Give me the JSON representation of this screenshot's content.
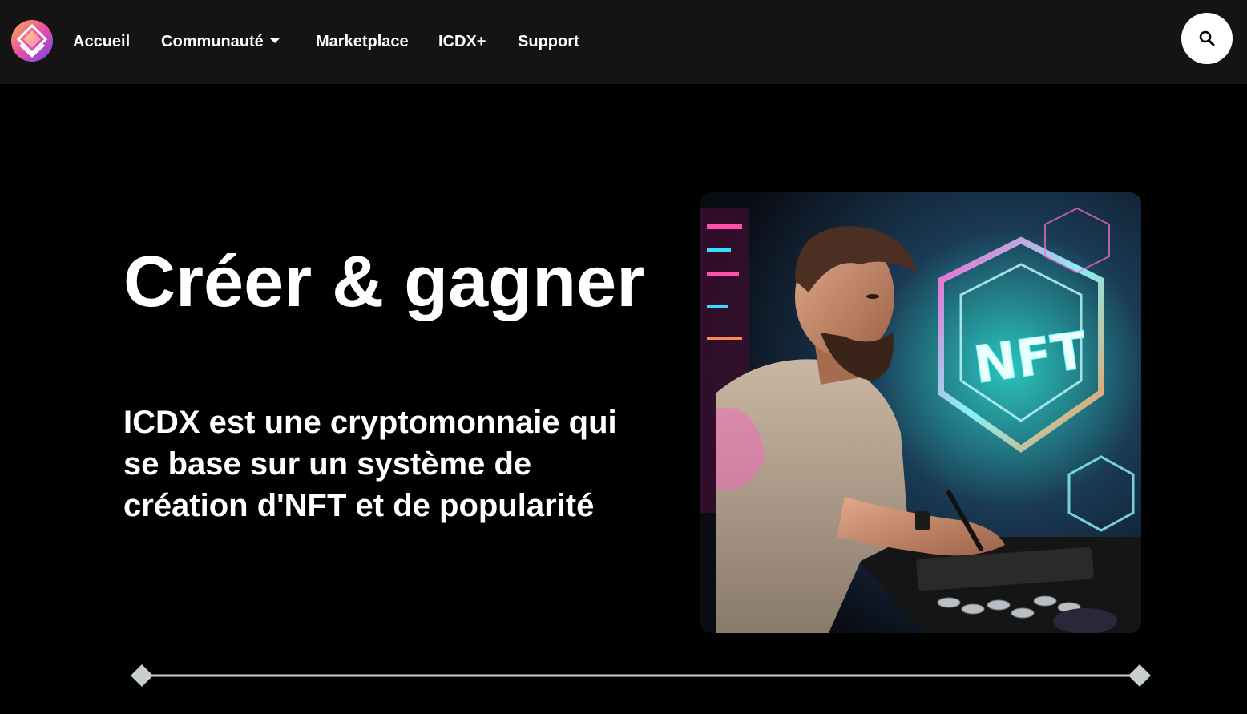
{
  "nav": {
    "items": [
      {
        "label": "Accueil"
      },
      {
        "label": "Communauté"
      },
      {
        "label": "Marketplace"
      },
      {
        "label": "ICDX+"
      },
      {
        "label": "Support"
      }
    ],
    "search_icon": "search-icon"
  },
  "hero": {
    "title": "Créer & gagner",
    "subtitle": "ICDX est une cryptomonnaie qui se base sur un système de création d'NFT et de popularité",
    "image_text": "NFT"
  },
  "colors": {
    "navbar_bg": "#141414",
    "page_bg": "#000000",
    "text": "#ffffff",
    "divider": "#c8cfcc",
    "logo_gradient": [
      "#f2a24b",
      "#e84fa8",
      "#7d4cf0"
    ]
  }
}
